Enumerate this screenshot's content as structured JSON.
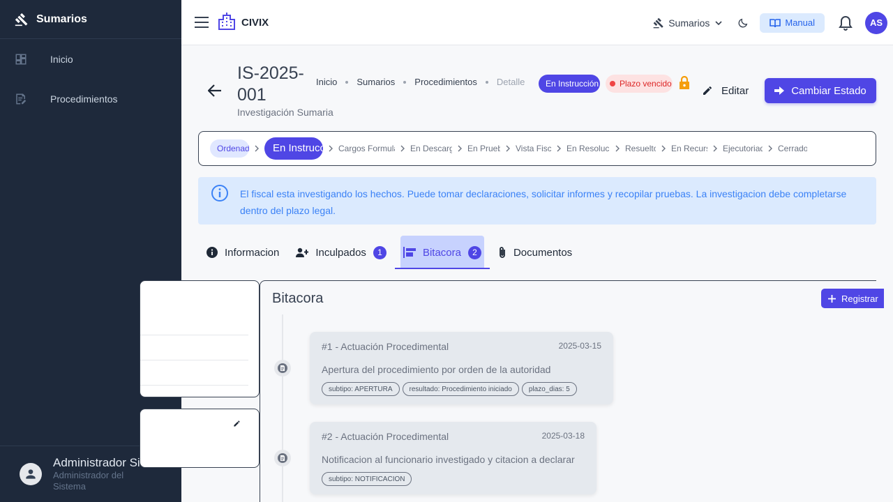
{
  "sidebar": {
    "title": "Sumarios",
    "items": [
      {
        "label": "Inicio"
      },
      {
        "label": "Procedimientos"
      }
    ],
    "user": {
      "name": "Administrador Sist...",
      "role": "Administrador del Sistema"
    }
  },
  "topbar": {
    "brand": "CIVIX",
    "module": "Sumarios",
    "manual": "Manual",
    "avatar": "AS"
  },
  "header": {
    "case_id": "IS-2025-001",
    "subtitle": "Investigación Sumaria",
    "breadcrumb": [
      "Inicio",
      "Sumarios",
      "Procedimientos",
      "Detalle"
    ],
    "state_badge": "En Instrucción",
    "overdue_badge": "Plazo vencido",
    "edit_label": "Editar",
    "change_state_label": "Cambiar Estado"
  },
  "stepper": {
    "steps": [
      "Ordenado",
      "En Instrucción",
      "Cargos Formulados",
      "En Descargos",
      "En Prueba",
      "Vista Fiscal",
      "En Resolución",
      "Resuelto",
      "En Recurso",
      "Ejecutoriado",
      "Cerrado"
    ]
  },
  "alert": {
    "text": "El fiscal esta investigando los hechos. Puede tomar declaraciones, solicitar informes y recopilar pruebas. La investigacion debe completarse dentro del plazo legal."
  },
  "tabs": [
    {
      "label": "Informacion"
    },
    {
      "label": "Inculpados",
      "count": "1"
    },
    {
      "label": "Bitacora",
      "count": "2"
    },
    {
      "label": "Documentos"
    }
  ],
  "bitacora": {
    "title": "Bitacora",
    "register_label": "Registrar",
    "entries": [
      {
        "title": "#1 - Actuación Procedimental",
        "date": "2025-03-15",
        "description": "Apertura del procedimiento por orden de la autoridad",
        "chips": [
          "subtipo: APERTURA",
          "resultado: Procedimiento iniciado",
          "plazo_dias: 5"
        ]
      },
      {
        "title": "#2 - Actuación Procedimental",
        "date": "2025-03-18",
        "description": "Notificacion al funcionario investigado y citacion a declarar",
        "chips": [
          "subtipo: NOTIFICACION"
        ]
      }
    ]
  },
  "colors": {
    "accent": "#4f46e5",
    "sidebar": "#1e293b",
    "info": "#3b82f6",
    "danger": "#dc2626"
  }
}
